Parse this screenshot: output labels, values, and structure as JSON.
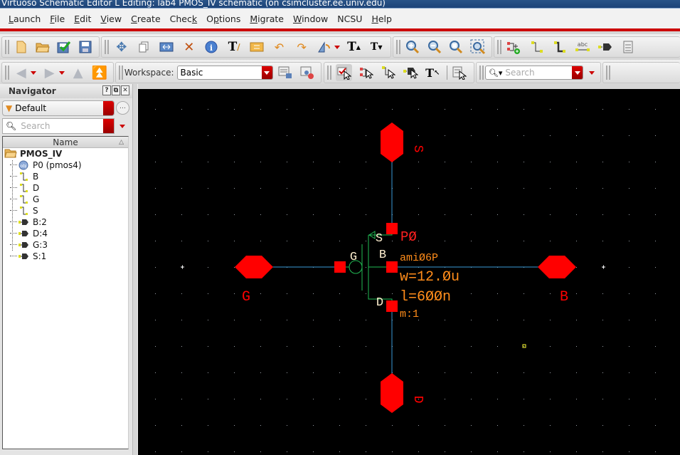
{
  "window": {
    "title": "Virtuoso Schematic Editor L Editing: lab4 PMOS_IV schematic (on csimcluster.ee.univ.edu)"
  },
  "menubar": {
    "items": [
      {
        "label": "Launch",
        "mnemonic": "L"
      },
      {
        "label": "File",
        "mnemonic": "F"
      },
      {
        "label": "Edit",
        "mnemonic": "E"
      },
      {
        "label": "View",
        "mnemonic": "V"
      },
      {
        "label": "Create",
        "mnemonic": "C"
      },
      {
        "label": "Check",
        "mnemonic": "k"
      },
      {
        "label": "Options",
        "mnemonic": "p"
      },
      {
        "label": "Migrate",
        "mnemonic": "M"
      },
      {
        "label": "Window",
        "mnemonic": "W"
      },
      {
        "label": "NCSU",
        "mnemonic": ""
      },
      {
        "label": "Help",
        "mnemonic": "H"
      }
    ]
  },
  "toolbar1": {
    "file_tools": [
      "new-icon",
      "open-icon",
      "check-and-save-icon",
      "save-icon"
    ],
    "edit_tools": [
      "move-icon",
      "copy-icon",
      "stretch-icon",
      "delete-icon",
      "properties-icon",
      "text-edit-icon",
      "replace-icon",
      "undo-icon",
      "redo-icon",
      "rotate-mirror-icon"
    ],
    "text_tools": [
      "text-larger-icon",
      "text-smaller-icon"
    ],
    "zoom_tools": [
      "zoom-in-icon",
      "zoom-out-icon",
      "zoom-fit-icon",
      "zoom-box-icon"
    ],
    "create_tools": [
      "add-instance-icon",
      "wire-icon",
      "wide-wire-icon",
      "wire-name-icon",
      "pin-icon",
      "symbol-icon"
    ]
  },
  "toolbar2": {
    "nav_tools": [
      "back-icon",
      "forward-icon",
      "up-icon",
      "top-icon"
    ],
    "workspace": {
      "label": "Workspace:",
      "value": "Basic"
    },
    "selection_tools": [
      "select-all-icon",
      "select-instances-icon",
      "select-nets-icon",
      "select-pins-icon",
      "select-text-icon",
      "select-options-icon"
    ],
    "search": {
      "placeholder": "Search"
    }
  },
  "navigator": {
    "title": "Navigator",
    "controls": [
      "?",
      "⧉",
      "✕"
    ],
    "filter": "Default",
    "search_placeholder": "Search",
    "column_header": "Name",
    "root": "PMOS_IV",
    "items": [
      {
        "label": "P0 (pmos4)",
        "type": "instance"
      },
      {
        "label": "B",
        "type": "net"
      },
      {
        "label": "D",
        "type": "net"
      },
      {
        "label": "G",
        "type": "net"
      },
      {
        "label": "S",
        "type": "net"
      },
      {
        "label": "B:2",
        "type": "pin"
      },
      {
        "label": "D:4",
        "type": "pin"
      },
      {
        "label": "G:3",
        "type": "pin"
      },
      {
        "label": "S:1",
        "type": "pin"
      }
    ]
  },
  "schematic": {
    "pins": [
      {
        "name": "S",
        "orientation": "vertical"
      },
      {
        "name": "D",
        "orientation": "vertical"
      },
      {
        "name": "G",
        "orientation": "horizontal"
      },
      {
        "name": "B",
        "orientation": "horizontal"
      }
    ],
    "instance": {
      "name": "P0",
      "model": "ami06P",
      "w": "w=12.0u",
      "l": "l=600n",
      "m": "m:1",
      "terminal_labels": [
        "S",
        "G",
        "B",
        "D"
      ]
    },
    "colors": {
      "background": "#000000",
      "pin": "#ff0000",
      "wire": "#3a9ad9",
      "device": "#22bb55",
      "inst_name": "#ff2020",
      "params": "#ff8c1a",
      "terminal_label": "#fff0d0",
      "grid": "#9aa0a8"
    }
  }
}
